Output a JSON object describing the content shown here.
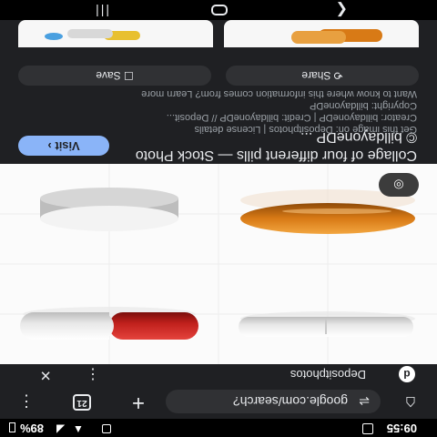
{
  "status_bar": {
    "time": "09:55",
    "battery": "89%"
  },
  "toolbar": {
    "home_icon": "home-icon",
    "url": "google.com/search?",
    "plus": "+",
    "tab_count": "21",
    "menu_icon": "⋮"
  },
  "source": {
    "logo": "d",
    "name": "Depositphotos",
    "menu_icon": "⋮",
    "close_icon": "×"
  },
  "image": {
    "lens_icon": "lens-icon"
  },
  "info": {
    "title": "Collage of four different pills — Stock Photo © billdayoneDP ...",
    "visit_label": "Visit",
    "meta_line1": "Get this image on: Depositphotos | License details",
    "meta_line2": "Creator: billdayoneDP | Credit: billdayoneDP // Deposit...",
    "meta_line3": "Copyright: billdayoneDP",
    "meta_line4": "Want to know where this information comes from? Learn more",
    "share_label": "Share",
    "save_label": "Save"
  },
  "colors": {
    "background": "#1f2023",
    "visit_button": "#8ab4f8",
    "pill_orange": "#d87a16",
    "pill_red": "#c0201c"
  }
}
